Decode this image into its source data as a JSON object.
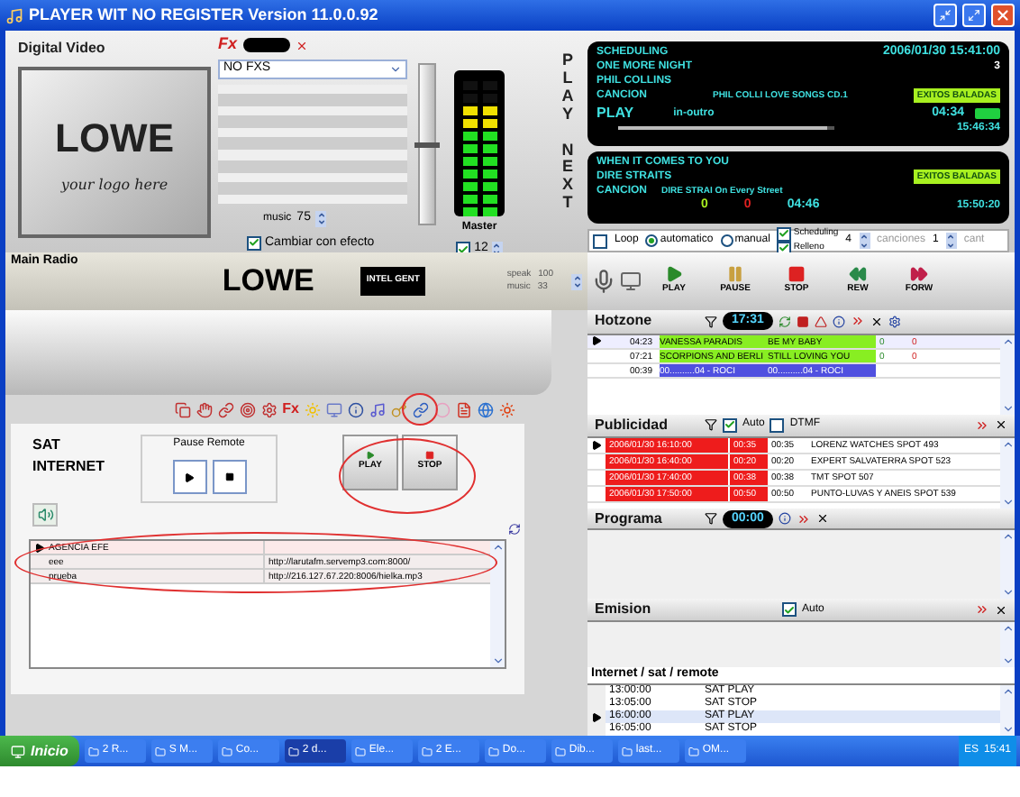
{
  "window": {
    "title": "PLAYER WIT NO REGISTER Version 11.0.0.92"
  },
  "video": {
    "label": "Digital Video",
    "logo": "LOWE",
    "tagline": "your logo here"
  },
  "fx": {
    "label": "Fx",
    "select": "NO FXS",
    "music_label": "music",
    "music_value": "75",
    "change_effect": {
      "label": "Cambiar con efecto",
      "checked": true
    }
  },
  "master": {
    "label": "Master",
    "value": "12",
    "checked": true,
    "level": 0.5
  },
  "meter": {
    "level": 0.82
  },
  "play_letters": "PLAY",
  "next_letters": "NEXT",
  "play_panel": {
    "mode_label": "SCHEDULING",
    "datetime": "2006/01/30 15:41:00",
    "title": "ONE MORE NIGHT",
    "artist": "PHIL COLLINS",
    "type": "CANCION",
    "album": "PHIL COLLI LOVE SONGS CD.1",
    "category": "EXITOS BALADAS",
    "counter": "3",
    "state": "PLAY",
    "segment": "in-outro",
    "duration": "04:34",
    "end_time": "15:46:34",
    "level": 0.97
  },
  "next_panel": {
    "title": "WHEN IT COMES TO YOU",
    "artist": "DIRE STRAITS",
    "type": "CANCION",
    "album": "DIRE STRAI On Every Street",
    "category": "EXITOS BALADAS",
    "value_a": "0",
    "value_b": "0",
    "duration": "04:46",
    "end_time": "15:50:20"
  },
  "options": {
    "loop": {
      "label": "Loop",
      "checked": false
    },
    "modes": [
      {
        "label": "automatico",
        "selected": true
      },
      {
        "label": "manual",
        "selected": false
      }
    ],
    "scheduling": {
      "label": "Scheduling",
      "checked": true
    },
    "relleno": {
      "label": "Relleno",
      "checked": true
    },
    "songs_value": "4",
    "songs_label": "canciones",
    "count_value": "1",
    "count_label": "cant"
  },
  "main_radio": {
    "label": "Main Radio",
    "logo": "LOWE",
    "mixer_label": "INTEL GENT",
    "speak_label": "speak",
    "speak_value": "100",
    "music_label": "music",
    "music_value": "33"
  },
  "transport": [
    {
      "kind": "play",
      "label": "PLAY"
    },
    {
      "kind": "pause",
      "label": "PAUSE"
    },
    {
      "kind": "stop",
      "label": "STOP"
    },
    {
      "kind": "rew",
      "label": "REW"
    },
    {
      "kind": "forw",
      "label": "FORW"
    }
  ],
  "toolbar_fx": "Fx",
  "hotzone": {
    "label": "Hotzone",
    "time": "17:31",
    "rows": [
      {
        "kind": "song",
        "selected": true,
        "time": "04:23",
        "artist": "VANESSA PARADIS",
        "title": "BE MY BABY",
        "col_a": "0",
        "col_b": "0"
      },
      {
        "kind": "song",
        "selected": false,
        "time": "07:21",
        "artist": "SCORPIONS AND BERLI",
        "title": "STILL LOVING YOU",
        "col_a": "0",
        "col_b": "0"
      },
      {
        "kind": "block",
        "selected": false,
        "time": "00:39",
        "artist": "00..........04 - ROCI",
        "title": "00..........04 - ROCI"
      }
    ]
  },
  "publicidad": {
    "label": "Publicidad",
    "auto": {
      "label": "Auto",
      "checked": true
    },
    "dtmf": {
      "label": "DTMF",
      "checked": false
    },
    "rows": [
      {
        "selected": true,
        "datetime": "2006/01/30  16:10:00",
        "dur_a": "00:35",
        "dur_b": "00:35",
        "title": "LORENZ WATCHES SPOT 493"
      },
      {
        "selected": false,
        "datetime": "2006/01/30  16:40:00",
        "dur_a": "00:20",
        "dur_b": "00:20",
        "title": "EXPERT SALVATERRA SPOT 523"
      },
      {
        "selected": false,
        "datetime": "2006/01/30  17:40:00",
        "dur_a": "00:38",
        "dur_b": "00:38",
        "title": "TMT SPOT 507"
      },
      {
        "selected": false,
        "datetime": "2006/01/30  17:50:00",
        "dur_a": "00:50",
        "dur_b": "00:50",
        "title": "PUNTO-LUVAS Y ANEIS SPOT 539"
      }
    ]
  },
  "programa": {
    "label": "Programa",
    "time": "00:00"
  },
  "emision": {
    "label": "Emision",
    "auto": {
      "label": "Auto",
      "checked": true
    }
  },
  "remote": {
    "label": "Internet / sat / remote",
    "rows": [
      {
        "selected": false,
        "time": "13:00:00",
        "action": "SAT PLAY"
      },
      {
        "selected": false,
        "time": "13:05:00",
        "action": "SAT STOP"
      },
      {
        "selected": true,
        "time": "16:00:00",
        "action": "SAT PLAY"
      },
      {
        "selected": false,
        "time": "16:05:00",
        "action": "SAT STOP"
      }
    ]
  },
  "sat": {
    "title_1": "SAT",
    "title_2": "INTERNET",
    "pause_label": "Pause Remote",
    "play": "PLAY",
    "stop": "STOP"
  },
  "streams": {
    "rows": [
      {
        "selected": true,
        "name": "AGENCIA EFE"
      },
      {
        "selected": false,
        "name": "eee",
        "url": "http://larutafm.servemp3.com:8000/"
      },
      {
        "selected": false,
        "name": "prueba",
        "url": "http://216.127.67.220:8006/hielka.mp3"
      }
    ]
  },
  "taskbar": {
    "start": "Inicio",
    "items": [
      {
        "label": "2 R...",
        "selected": false
      },
      {
        "label": "S M...",
        "selected": false
      },
      {
        "label": "Co...",
        "selected": false
      },
      {
        "label": "2 d...",
        "selected": true
      },
      {
        "label": "Ele...",
        "selected": false
      },
      {
        "label": "2 E...",
        "selected": false
      },
      {
        "label": "Do...",
        "selected": false
      },
      {
        "label": "Dib...",
        "selected": false
      },
      {
        "label": "last...",
        "selected": false
      },
      {
        "label": "OM...",
        "selected": false
      }
    ],
    "lang": "ES",
    "clock": "15:41"
  }
}
